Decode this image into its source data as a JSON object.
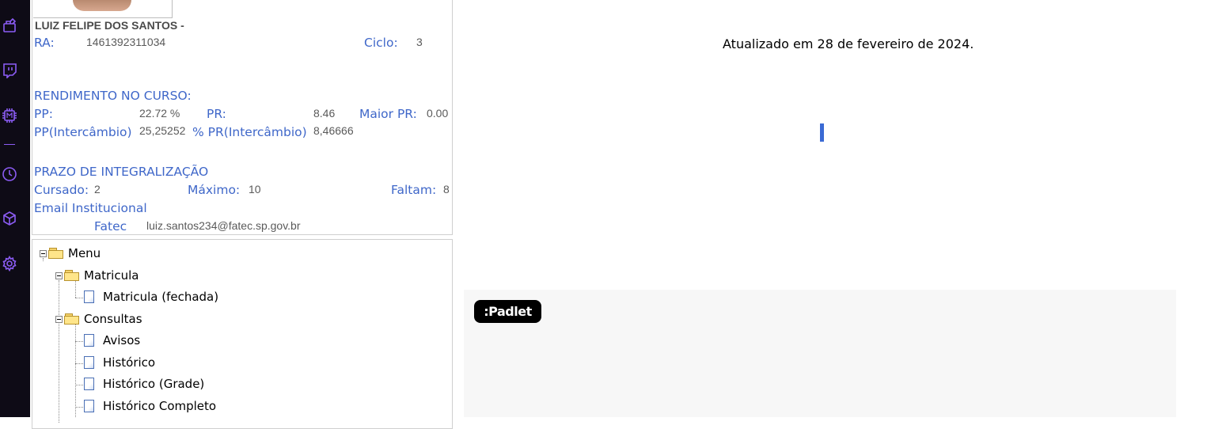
{
  "student": {
    "name": "LUIZ FELIPE DOS SANTOS -",
    "ra_label": "RA:",
    "ra_value": "1461392311034",
    "ciclo_label": "Ciclo:",
    "ciclo_value": "3"
  },
  "rendimento": {
    "heading": "RENDIMENTO NO CURSO:",
    "pp_label": "PP:",
    "pp_value": "22.72 %",
    "pr_label": "PR:",
    "pr_value": "8.46",
    "maior_pr_label": "Maior PR:",
    "maior_pr_value": "0.00",
    "pp_inter_label": "PP(Intercâmbio)",
    "pp_inter_value": "25,25252",
    "pr_inter_label": "% PR(Intercâmbio)",
    "pr_inter_value": "8,46666"
  },
  "prazo": {
    "heading": "PRAZO DE INTEGRALIZAÇÃO",
    "cursado_label": "Cursado:",
    "cursado_value": "2",
    "maximo_label": "Máximo:",
    "maximo_value": "10",
    "faltam_label": "Faltam:",
    "faltam_value": "8"
  },
  "email": {
    "label_line1": "Email Institucional",
    "label_line2": "Fatec",
    "value": "luiz.santos234@fatec.sp.gov.br"
  },
  "menu_tree": {
    "root": "Menu",
    "matricula": "Matricula",
    "matricula_fechada": "Matricula (fechada)",
    "consultas": "Consultas",
    "avisos": "Avisos",
    "historico": "Histórico",
    "historico_grade": "Histórico (Grade)",
    "historico_completo": "Histórico Completo"
  },
  "main": {
    "updated_text": "Atualizado em 28 de fevereiro de 2024.",
    "padlet_logo": ":Padlet"
  },
  "rail_icons": [
    "extension-icon",
    "twitch-icon",
    "chip-icon",
    "clock-icon",
    "cube-icon",
    "gear-icon"
  ],
  "colors": {
    "label_blue": "#3f67c9",
    "rail_bg": "#0e0b16",
    "rail_icon": "#8c5cf5"
  }
}
